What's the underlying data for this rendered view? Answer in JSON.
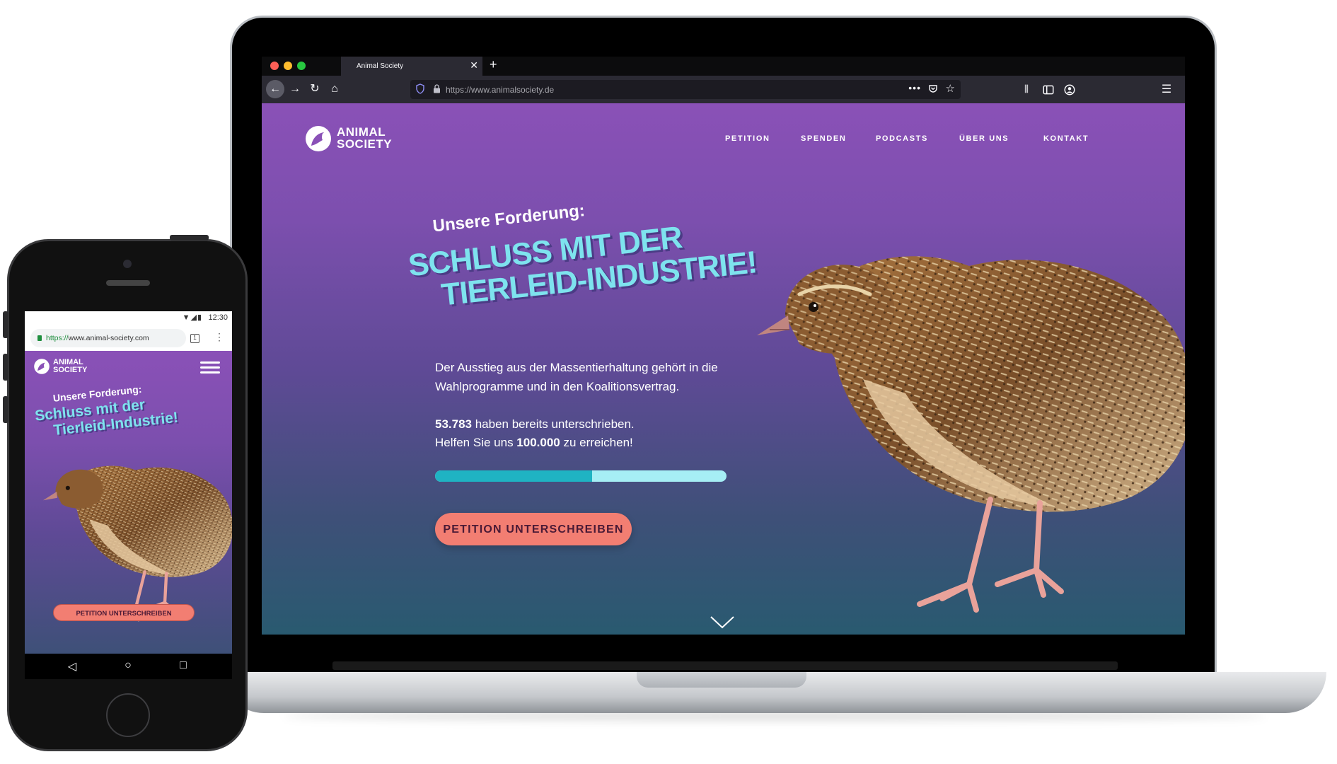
{
  "browser": {
    "tab_title": "Animal Society",
    "tab_close": "✕",
    "new_tab": "+",
    "url": "https://www.animalsociety.de",
    "page_actions": "•••",
    "menu": "☰"
  },
  "site": {
    "logo_text": "ANIMAL SOCIETY",
    "nav": {
      "petition": "PETITION",
      "spenden": "SPENDEN",
      "podcasts": "PODCASTS",
      "ueber": "ÜBER UNS",
      "kontakt": "KONTAKT"
    },
    "kicker": "Unsere Forderung:",
    "headline_line1": "SCHLUSS MIT DER",
    "headline_line2": "TIERLEID-INDUSTRIE!",
    "intro": "Der Ausstieg aus der Massentierhaltung gehört in die Wahlprogramme und in den Koalitionsvertrag.",
    "signature_count": "53.783",
    "signature_suffix": " haben bereits unterschrieben.",
    "goal_prefix": "Helfen Sie uns ",
    "goal_value": "100.000",
    "goal_suffix": " zu erreichen!",
    "progress_fraction": 0.54,
    "cta_label": "PETITION UNTERSCHREIBEN",
    "colors": {
      "accent": "#7ee3ee",
      "cta": "#f27e72",
      "progress_fill": "#1fb3c3",
      "progress_track": "#a6eef5"
    }
  },
  "mobile": {
    "status_time": "12:30",
    "status_icons": "▼◢▮",
    "url_scheme": "https://",
    "url_host": "www.animal-society.com",
    "tab_count": "1",
    "menu_dots": "⋮",
    "logo_text": "ANIMAL SOCIETY",
    "kicker": "Unsere Forderung:",
    "headline_line1": "Schluss mit der",
    "headline_line2": "Tierleid-Industrie!",
    "cta_label": "PETITION UNTERSCHREIBEN",
    "nav_back": "◁",
    "nav_home": "○",
    "nav_recent": "□"
  }
}
